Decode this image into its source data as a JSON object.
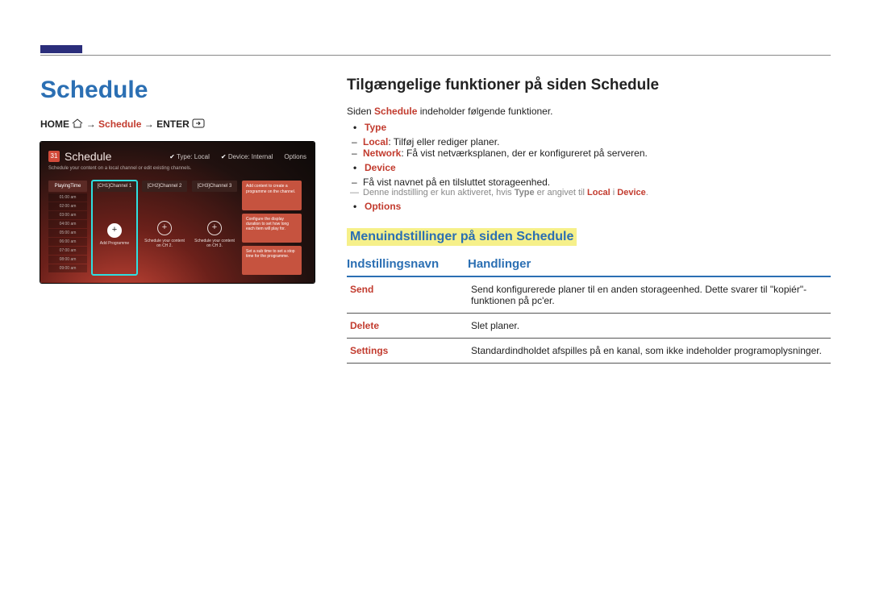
{
  "left": {
    "title": "Schedule",
    "breadcrumb": {
      "home": "HOME",
      "arrow": "→",
      "schedule": "Schedule",
      "enter": "ENTER"
    }
  },
  "mock": {
    "title": "Schedule",
    "cal_day": "31",
    "subtitle": "Schedule your content on a local channel or edit existing channels.",
    "topright": {
      "type_label": "Type:",
      "type_value": "Local",
      "device_label": "Device:",
      "device_value": "Internal",
      "options": "Options"
    },
    "time_header": "PlayingTime",
    "times": [
      "01:00 am",
      "02:00 am",
      "03:00 am",
      "04:00 am",
      "05:00 am",
      "06:00 am",
      "07:00 am",
      "08:00 am",
      "09:00 am"
    ],
    "channels": [
      "[CH1]Channel 1",
      "[CH2]Channel 2",
      "[CH3]Channel 3"
    ],
    "add_label": "Add Programme",
    "ch2_label": "Schedule your content on CH 2.",
    "ch3_label": "Schedule your content on CH 3.",
    "tips": [
      "Add content to create a programme on the channel.",
      "Configure the display duration to set how long each item will play for.",
      "Set a sub time to set a stop time for the programme."
    ]
  },
  "right": {
    "h2": "Tilgængelige funktioner på siden Schedule",
    "intro_a": "Siden ",
    "intro_b": "Schedule",
    "intro_c": " indeholder følgende funktioner.",
    "type": {
      "label": "Type",
      "local_k": "Local",
      "local_v": ": Tilføj eller rediger planer.",
      "network_k": "Network",
      "network_v": ": Få vist netværksplanen, der er konfigureret på serveren."
    },
    "device": {
      "label": "Device",
      "line": "Få vist navnet på en tilsluttet storageenhed.",
      "note_a": "Denne indstilling er kun aktiveret, hvis ",
      "note_b": "Type",
      "note_c": " er angivet til ",
      "note_d": "Local",
      "note_e": " i ",
      "note_f": "Device",
      "note_g": "."
    },
    "options_label": "Options",
    "subsec": "Menuindstillinger på siden Schedule",
    "table": {
      "col1": "Indstillingsnavn",
      "col2": "Handlinger",
      "rows": [
        {
          "name": "Send",
          "desc": "Send konfigurerede planer til en anden storageenhed. Dette svarer til \"kopiér\"-funktionen på pc'er."
        },
        {
          "name": "Delete",
          "desc": "Slet planer."
        },
        {
          "name": "Settings",
          "desc": "Standardindholdet afspilles på en kanal, som ikke indeholder programoplysninger."
        }
      ]
    }
  }
}
